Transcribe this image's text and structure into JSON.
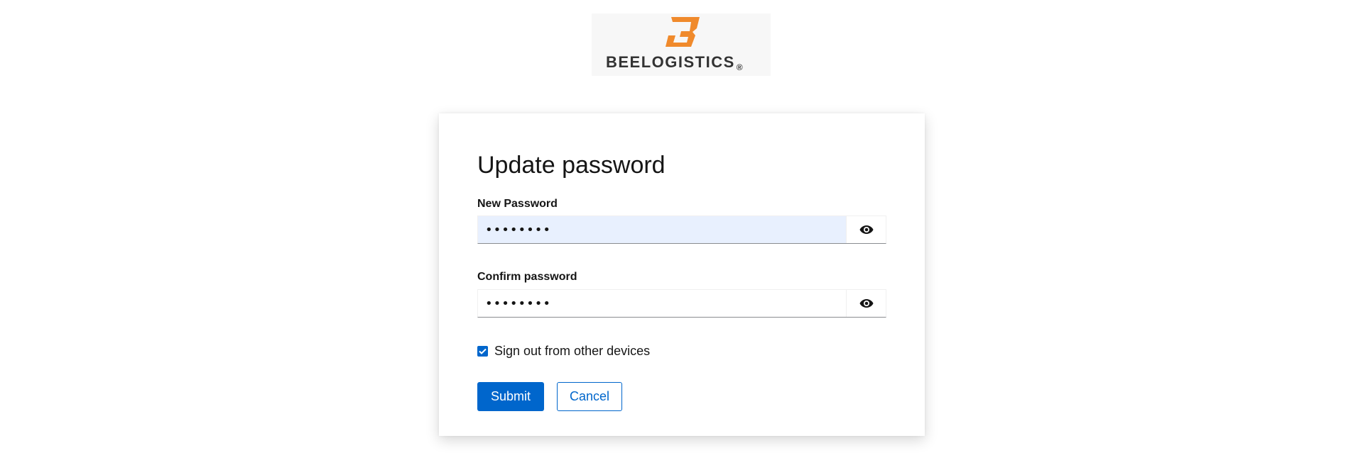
{
  "brand": {
    "name": "BEELOGISTICS",
    "registered": "®",
    "accent_color": "#f08a2c"
  },
  "form": {
    "title": "Update password",
    "new_password": {
      "label": "New Password",
      "value": "••••••••",
      "toggle_icon": "eye-icon"
    },
    "confirm_password": {
      "label": "Confirm password",
      "value": "••••••••",
      "toggle_icon": "eye-icon"
    },
    "sign_out_other_devices": {
      "label": "Sign out from other devices",
      "checked": true
    },
    "submit_label": "Submit",
    "cancel_label": "Cancel"
  },
  "colors": {
    "primary": "#0066cc",
    "autofill_bg": "#e8f0fe"
  }
}
